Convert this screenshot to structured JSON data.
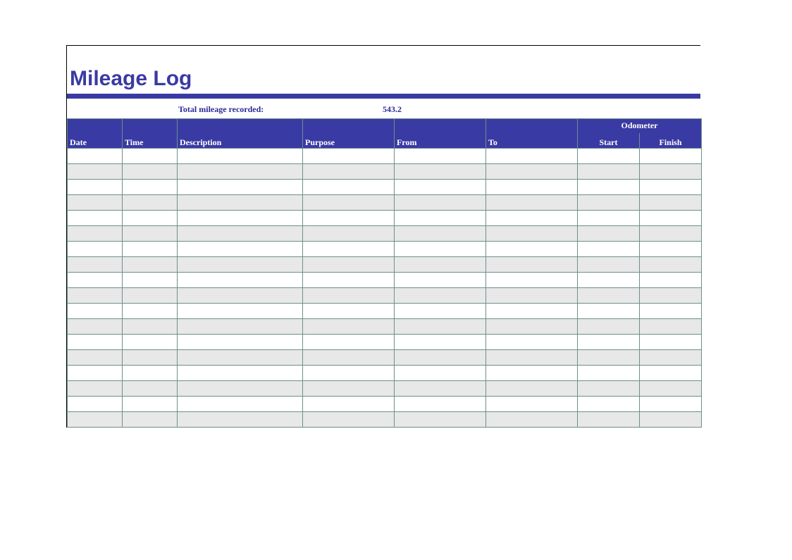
{
  "title": "Mileage Log",
  "totals": {
    "label": "Total mileage recorded:",
    "value": "543.2"
  },
  "columns": {
    "date": "Date",
    "time": "Time",
    "description": "Description",
    "purpose": "Purpose",
    "from": "From",
    "to": "To",
    "odometer_group": "Odometer",
    "start": "Start",
    "finish": "Finish"
  },
  "rows": [
    {
      "date": "",
      "time": "",
      "description": "",
      "purpose": "",
      "from": "",
      "to": "",
      "start": "",
      "finish": ""
    },
    {
      "date": "",
      "time": "",
      "description": "",
      "purpose": "",
      "from": "",
      "to": "",
      "start": "",
      "finish": ""
    },
    {
      "date": "",
      "time": "",
      "description": "",
      "purpose": "",
      "from": "",
      "to": "",
      "start": "",
      "finish": ""
    },
    {
      "date": "",
      "time": "",
      "description": "",
      "purpose": "",
      "from": "",
      "to": "",
      "start": "",
      "finish": ""
    },
    {
      "date": "",
      "time": "",
      "description": "",
      "purpose": "",
      "from": "",
      "to": "",
      "start": "",
      "finish": ""
    },
    {
      "date": "",
      "time": "",
      "description": "",
      "purpose": "",
      "from": "",
      "to": "",
      "start": "",
      "finish": ""
    },
    {
      "date": "",
      "time": "",
      "description": "",
      "purpose": "",
      "from": "",
      "to": "",
      "start": "",
      "finish": ""
    },
    {
      "date": "",
      "time": "",
      "description": "",
      "purpose": "",
      "from": "",
      "to": "",
      "start": "",
      "finish": ""
    },
    {
      "date": "",
      "time": "",
      "description": "",
      "purpose": "",
      "from": "",
      "to": "",
      "start": "",
      "finish": ""
    },
    {
      "date": "",
      "time": "",
      "description": "",
      "purpose": "",
      "from": "",
      "to": "",
      "start": "",
      "finish": ""
    },
    {
      "date": "",
      "time": "",
      "description": "",
      "purpose": "",
      "from": "",
      "to": "",
      "start": "",
      "finish": ""
    },
    {
      "date": "",
      "time": "",
      "description": "",
      "purpose": "",
      "from": "",
      "to": "",
      "start": "",
      "finish": ""
    },
    {
      "date": "",
      "time": "",
      "description": "",
      "purpose": "",
      "from": "",
      "to": "",
      "start": "",
      "finish": ""
    },
    {
      "date": "",
      "time": "",
      "description": "",
      "purpose": "",
      "from": "",
      "to": "",
      "start": "",
      "finish": ""
    },
    {
      "date": "",
      "time": "",
      "description": "",
      "purpose": "",
      "from": "",
      "to": "",
      "start": "",
      "finish": ""
    },
    {
      "date": "",
      "time": "",
      "description": "",
      "purpose": "",
      "from": "",
      "to": "",
      "start": "",
      "finish": ""
    },
    {
      "date": "",
      "time": "",
      "description": "",
      "purpose": "",
      "from": "",
      "to": "",
      "start": "",
      "finish": ""
    },
    {
      "date": "",
      "time": "",
      "description": "",
      "purpose": "",
      "from": "",
      "to": "",
      "start": "",
      "finish": ""
    }
  ]
}
